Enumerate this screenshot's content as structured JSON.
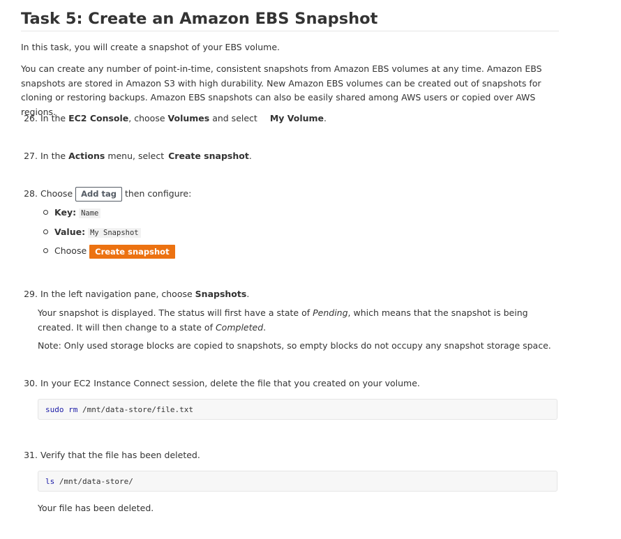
{
  "title": "Task 5: Create an Amazon EBS Snapshot",
  "intro": "In this task, you will create a snapshot of your EBS volume.",
  "description": "You can create any number of point-in-time, consistent snapshots from Amazon EBS volumes at any time. Amazon EBS snapshots are stored in Amazon S3 with high durability. New Amazon EBS volumes can be created out of snapshots for cloning or restoring backups. Amazon EBS snapshots can also be easily shared among AWS users or copied over AWS regions.",
  "step26": {
    "num": "26.",
    "t1": "In the ",
    "b1": "EC2 Console",
    "t2": ", choose ",
    "b2": "Volumes",
    "t3": " and select",
    "b3": "My Volume",
    "t4": "."
  },
  "step27": {
    "num": "27.",
    "t1": "In the ",
    "b1": "Actions",
    "t2": " menu, select",
    "b2": "Create snapshot",
    "t3": "."
  },
  "step28": {
    "num": "28.",
    "t1": "Choose",
    "button": "Add tag",
    "t2": "then configure:",
    "key_label": "Key:",
    "key_value": "Name",
    "value_label": "Value:",
    "value_value": "My Snapshot",
    "choose_text": "Choose",
    "create_button": "Create snapshot"
  },
  "step29": {
    "num": "29.",
    "t1": "In the left navigation pane, choose ",
    "b1": "Snapshots",
    "t2": ".",
    "p1a": "Your snapshot is displayed. The status will first have a state of ",
    "p1i1": "Pending",
    "p1b": ", which means that the snapshot is being created. It will then change to a state of ",
    "p1i2": "Completed",
    "p1c": ".",
    "note": "Note: Only used storage blocks are copied to snapshots, so empty blocks do not occupy any snapshot storage space."
  },
  "step30": {
    "num": "30.",
    "text": "In your EC2 Instance Connect session, delete the file that you created on your volume.",
    "code_cmd1": "sudo",
    "code_cmd2": "rm",
    "code_arg": "/mnt/data-store/file.txt"
  },
  "step31": {
    "num": "31.",
    "text": "Verify that the file has been deleted.",
    "code_cmd": "ls",
    "code_arg": "/mnt/data-store/",
    "result": "Your file has been deleted."
  },
  "colors": {
    "text": "#333333",
    "orange_button": "#ec7211",
    "code_background": "#f7f7f7",
    "code_keyword": "#1a1aa6"
  }
}
